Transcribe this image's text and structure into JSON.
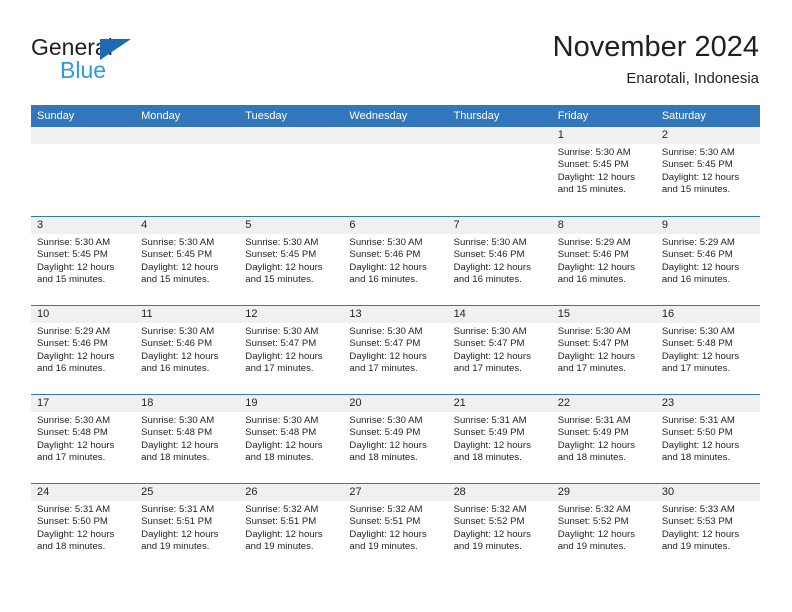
{
  "brand": {
    "line1": "General",
    "line2": "Blue",
    "triangle_color": "#1b6ab3",
    "line2_color": "#2e9ae0"
  },
  "header": {
    "title": "November 2024",
    "subtitle": "Enarotali, Indonesia"
  },
  "theme": {
    "header_blue": "#3277bc",
    "daynum_band": "#f0f0f0",
    "text": "#231f20"
  },
  "calendar": {
    "weekday_headers": [
      "Sunday",
      "Monday",
      "Tuesday",
      "Wednesday",
      "Thursday",
      "Friday",
      "Saturday"
    ],
    "weeks": [
      [
        {
          "day": "",
          "empty": true
        },
        {
          "day": "",
          "empty": true
        },
        {
          "day": "",
          "empty": true
        },
        {
          "day": "",
          "empty": true
        },
        {
          "day": "",
          "empty": true
        },
        {
          "day": "1",
          "sunrise": "Sunrise: 5:30 AM",
          "sunset": "Sunset: 5:45 PM",
          "daylight1": "Daylight: 12 hours",
          "daylight2": "and 15 minutes."
        },
        {
          "day": "2",
          "sunrise": "Sunrise: 5:30 AM",
          "sunset": "Sunset: 5:45 PM",
          "daylight1": "Daylight: 12 hours",
          "daylight2": "and 15 minutes."
        }
      ],
      [
        {
          "day": "3",
          "sunrise": "Sunrise: 5:30 AM",
          "sunset": "Sunset: 5:45 PM",
          "daylight1": "Daylight: 12 hours",
          "daylight2": "and 15 minutes."
        },
        {
          "day": "4",
          "sunrise": "Sunrise: 5:30 AM",
          "sunset": "Sunset: 5:45 PM",
          "daylight1": "Daylight: 12 hours",
          "daylight2": "and 15 minutes."
        },
        {
          "day": "5",
          "sunrise": "Sunrise: 5:30 AM",
          "sunset": "Sunset: 5:45 PM",
          "daylight1": "Daylight: 12 hours",
          "daylight2": "and 15 minutes."
        },
        {
          "day": "6",
          "sunrise": "Sunrise: 5:30 AM",
          "sunset": "Sunset: 5:46 PM",
          "daylight1": "Daylight: 12 hours",
          "daylight2": "and 16 minutes."
        },
        {
          "day": "7",
          "sunrise": "Sunrise: 5:30 AM",
          "sunset": "Sunset: 5:46 PM",
          "daylight1": "Daylight: 12 hours",
          "daylight2": "and 16 minutes."
        },
        {
          "day": "8",
          "sunrise": "Sunrise: 5:29 AM",
          "sunset": "Sunset: 5:46 PM",
          "daylight1": "Daylight: 12 hours",
          "daylight2": "and 16 minutes."
        },
        {
          "day": "9",
          "sunrise": "Sunrise: 5:29 AM",
          "sunset": "Sunset: 5:46 PM",
          "daylight1": "Daylight: 12 hours",
          "daylight2": "and 16 minutes."
        }
      ],
      [
        {
          "day": "10",
          "sunrise": "Sunrise: 5:29 AM",
          "sunset": "Sunset: 5:46 PM",
          "daylight1": "Daylight: 12 hours",
          "daylight2": "and 16 minutes."
        },
        {
          "day": "11",
          "sunrise": "Sunrise: 5:30 AM",
          "sunset": "Sunset: 5:46 PM",
          "daylight1": "Daylight: 12 hours",
          "daylight2": "and 16 minutes."
        },
        {
          "day": "12",
          "sunrise": "Sunrise: 5:30 AM",
          "sunset": "Sunset: 5:47 PM",
          "daylight1": "Daylight: 12 hours",
          "daylight2": "and 17 minutes."
        },
        {
          "day": "13",
          "sunrise": "Sunrise: 5:30 AM",
          "sunset": "Sunset: 5:47 PM",
          "daylight1": "Daylight: 12 hours",
          "daylight2": "and 17 minutes."
        },
        {
          "day": "14",
          "sunrise": "Sunrise: 5:30 AM",
          "sunset": "Sunset: 5:47 PM",
          "daylight1": "Daylight: 12 hours",
          "daylight2": "and 17 minutes."
        },
        {
          "day": "15",
          "sunrise": "Sunrise: 5:30 AM",
          "sunset": "Sunset: 5:47 PM",
          "daylight1": "Daylight: 12 hours",
          "daylight2": "and 17 minutes."
        },
        {
          "day": "16",
          "sunrise": "Sunrise: 5:30 AM",
          "sunset": "Sunset: 5:48 PM",
          "daylight1": "Daylight: 12 hours",
          "daylight2": "and 17 minutes."
        }
      ],
      [
        {
          "day": "17",
          "sunrise": "Sunrise: 5:30 AM",
          "sunset": "Sunset: 5:48 PM",
          "daylight1": "Daylight: 12 hours",
          "daylight2": "and 17 minutes."
        },
        {
          "day": "18",
          "sunrise": "Sunrise: 5:30 AM",
          "sunset": "Sunset: 5:48 PM",
          "daylight1": "Daylight: 12 hours",
          "daylight2": "and 18 minutes."
        },
        {
          "day": "19",
          "sunrise": "Sunrise: 5:30 AM",
          "sunset": "Sunset: 5:48 PM",
          "daylight1": "Daylight: 12 hours",
          "daylight2": "and 18 minutes."
        },
        {
          "day": "20",
          "sunrise": "Sunrise: 5:30 AM",
          "sunset": "Sunset: 5:49 PM",
          "daylight1": "Daylight: 12 hours",
          "daylight2": "and 18 minutes."
        },
        {
          "day": "21",
          "sunrise": "Sunrise: 5:31 AM",
          "sunset": "Sunset: 5:49 PM",
          "daylight1": "Daylight: 12 hours",
          "daylight2": "and 18 minutes."
        },
        {
          "day": "22",
          "sunrise": "Sunrise: 5:31 AM",
          "sunset": "Sunset: 5:49 PM",
          "daylight1": "Daylight: 12 hours",
          "daylight2": "and 18 minutes."
        },
        {
          "day": "23",
          "sunrise": "Sunrise: 5:31 AM",
          "sunset": "Sunset: 5:50 PM",
          "daylight1": "Daylight: 12 hours",
          "daylight2": "and 18 minutes."
        }
      ],
      [
        {
          "day": "24",
          "sunrise": "Sunrise: 5:31 AM",
          "sunset": "Sunset: 5:50 PM",
          "daylight1": "Daylight: 12 hours",
          "daylight2": "and 18 minutes."
        },
        {
          "day": "25",
          "sunrise": "Sunrise: 5:31 AM",
          "sunset": "Sunset: 5:51 PM",
          "daylight1": "Daylight: 12 hours",
          "daylight2": "and 19 minutes."
        },
        {
          "day": "26",
          "sunrise": "Sunrise: 5:32 AM",
          "sunset": "Sunset: 5:51 PM",
          "daylight1": "Daylight: 12 hours",
          "daylight2": "and 19 minutes."
        },
        {
          "day": "27",
          "sunrise": "Sunrise: 5:32 AM",
          "sunset": "Sunset: 5:51 PM",
          "daylight1": "Daylight: 12 hours",
          "daylight2": "and 19 minutes."
        },
        {
          "day": "28",
          "sunrise": "Sunrise: 5:32 AM",
          "sunset": "Sunset: 5:52 PM",
          "daylight1": "Daylight: 12 hours",
          "daylight2": "and 19 minutes."
        },
        {
          "day": "29",
          "sunrise": "Sunrise: 5:32 AM",
          "sunset": "Sunset: 5:52 PM",
          "daylight1": "Daylight: 12 hours",
          "daylight2": "and 19 minutes."
        },
        {
          "day": "30",
          "sunrise": "Sunrise: 5:33 AM",
          "sunset": "Sunset: 5:53 PM",
          "daylight1": "Daylight: 12 hours",
          "daylight2": "and 19 minutes."
        }
      ]
    ]
  }
}
